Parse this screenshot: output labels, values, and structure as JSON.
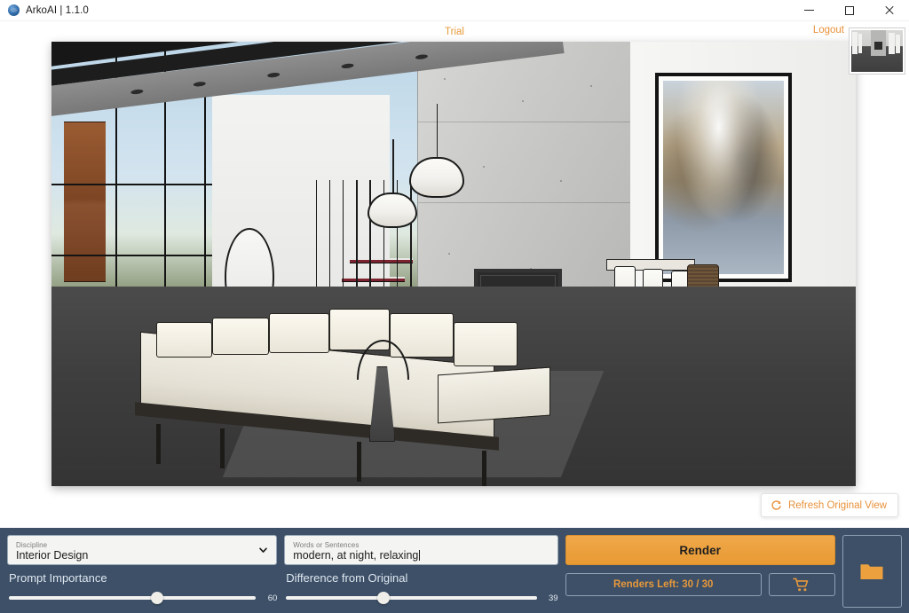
{
  "window": {
    "title": "ArkoAI | 1.1.0",
    "app_icon": "arkoai-logo-icon",
    "minimize": "minimize-icon",
    "maximize": "maximize-icon",
    "close": "close-icon"
  },
  "header": {
    "plan_label": "Trial",
    "logout_label": "Logout",
    "thumbnail_alt": "render-thumbnail"
  },
  "viewport": {
    "refresh_button_label": "Refresh Original View",
    "refresh_icon": "refresh-icon",
    "scene_description": "3D SketchUp interior viewport"
  },
  "controls": {
    "discipline": {
      "label": "Discipline",
      "value": "Interior Design",
      "chevron_icon": "chevron-down-icon",
      "options": [
        "Interior Design"
      ]
    },
    "prompt": {
      "label": "Words or Sentences",
      "value": "modern, at night, relaxing",
      "placeholder": "Words or Sentences"
    },
    "prompt_importance": {
      "label": "Prompt Importance",
      "value": "60",
      "percent": 60
    },
    "difference_from_original": {
      "label": "Difference from Original",
      "value": "39",
      "percent": 39
    },
    "render_button_label": "Render",
    "renders_left_label": "Renders Left: 30 / 30",
    "cart_icon": "shopping-cart-icon",
    "folder_icon": "folder-icon"
  },
  "colors": {
    "panel_bg": "#3d5068",
    "accent_orange": "#e8993a",
    "render_button": "#eda13e",
    "text_light": "#dfe7ef"
  }
}
